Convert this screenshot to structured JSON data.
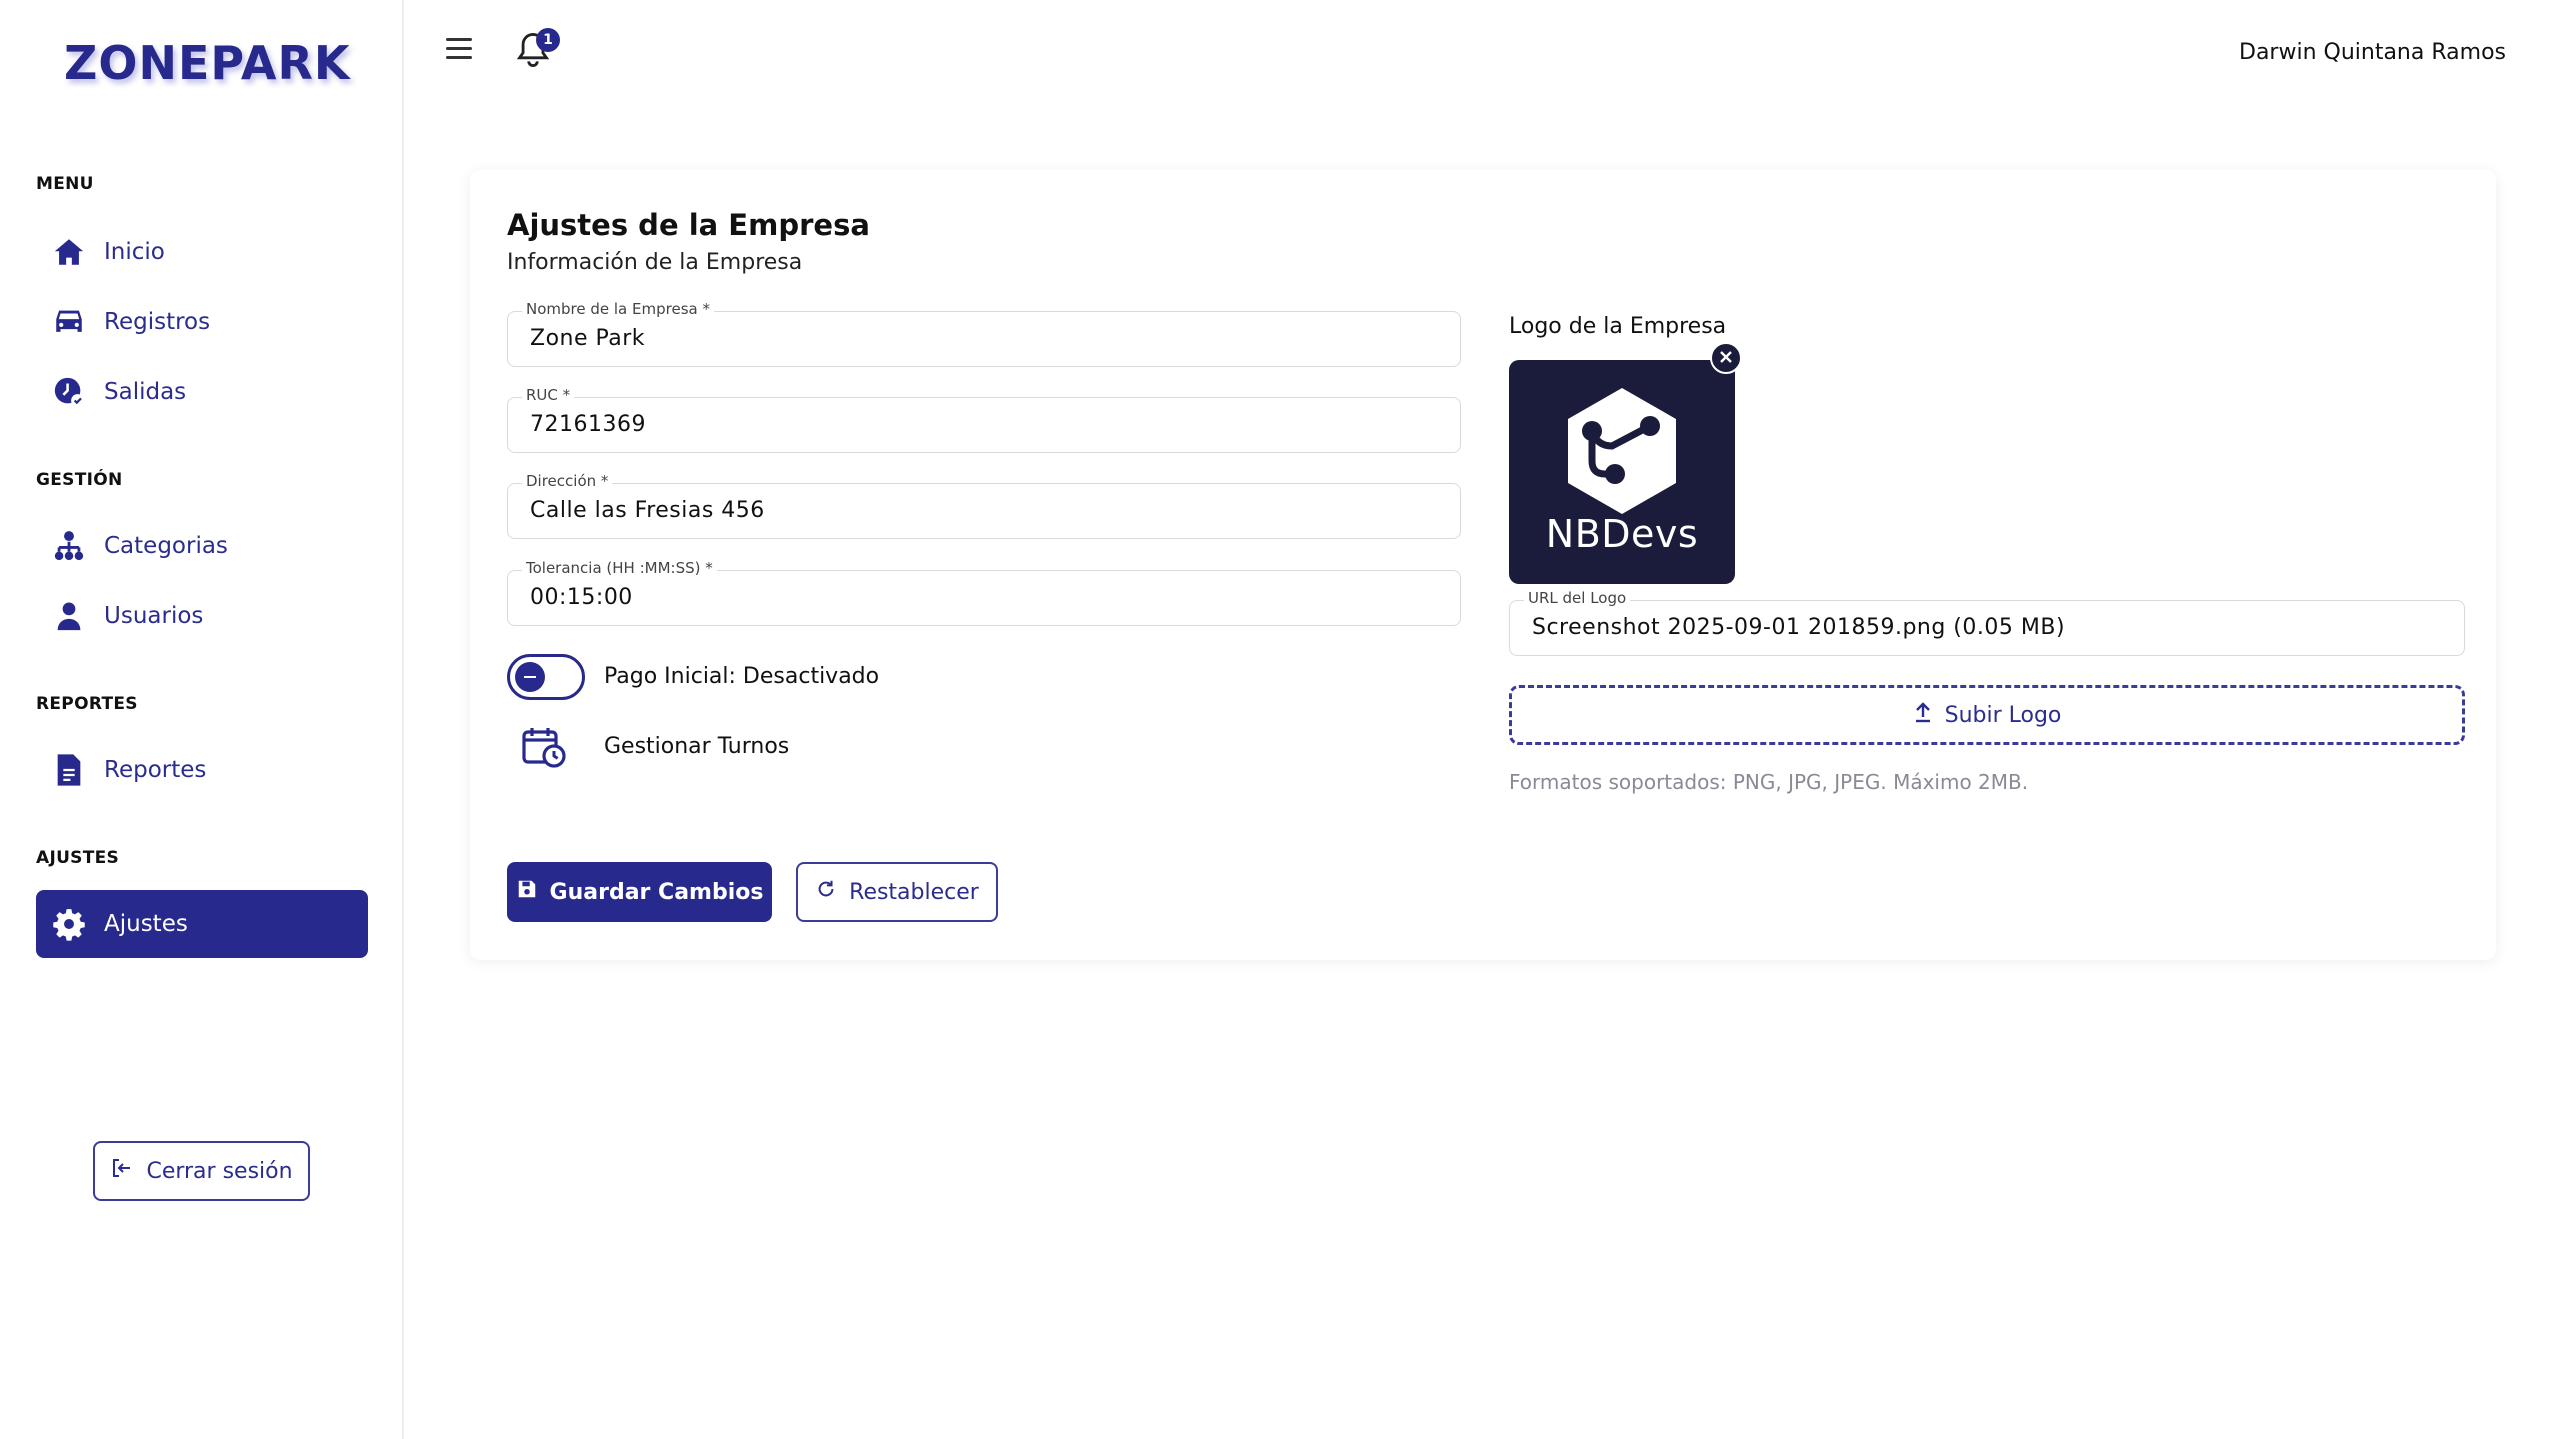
{
  "brand": {
    "part1": "ZONE",
    "part2": "PARK"
  },
  "sidebar": {
    "sections": [
      {
        "label": "MENU"
      },
      {
        "label": "GESTIÓN"
      },
      {
        "label": "REPORTES"
      },
      {
        "label": "AJUSTES"
      }
    ],
    "items": [
      {
        "label": "Inicio",
        "icon": "home-icon"
      },
      {
        "label": "Registros",
        "icon": "car-icon"
      },
      {
        "label": "Salidas",
        "icon": "clock-check-icon"
      },
      {
        "label": "Categorias",
        "icon": "hierarchy-icon"
      },
      {
        "label": "Usuarios",
        "icon": "user-icon"
      },
      {
        "label": "Reportes",
        "icon": "document-icon"
      },
      {
        "label": "Ajustes",
        "icon": "gear-icon",
        "active": true
      }
    ],
    "logout_label": "Cerrar sesión"
  },
  "header": {
    "notification_count": "1",
    "user_name": "Darwin Quintana Ramos"
  },
  "card": {
    "title": "Ajustes de la Empresa",
    "subtitle": "Información de la Empresa",
    "fields": [
      {
        "label": "Nombre de la Empresa *",
        "value": "Zone Park"
      },
      {
        "label": "RUC *",
        "value": "72161369"
      },
      {
        "label": "Dirección *",
        "value": "Calle las Fresias 456"
      },
      {
        "label": "Tolerancia (HH :MM:SS) *",
        "value": "00:15:00"
      }
    ],
    "toggle_label": "Pago Inicial: Desactivado",
    "toggle_on": false,
    "turnos_label": "Gestionar Turnos",
    "save_label": "Guardar Cambios",
    "reset_label": "Restablecer",
    "logo": {
      "title": "Logo de la Empresa",
      "image_text": "NBDevs",
      "url_label": "URL del Logo",
      "url_value": "Screenshot 2025-09-01 201859.png (0.05 MB)",
      "upload_label": "Subir Logo",
      "formats_note": "Formatos soportados: PNG, JPG, JPEG. Máximo 2MB."
    }
  },
  "colors": {
    "primary": "#272a8c",
    "logo_bg": "#1b1b3b",
    "muted_text": "#8a8a96",
    "border": "#d9d9e0"
  }
}
